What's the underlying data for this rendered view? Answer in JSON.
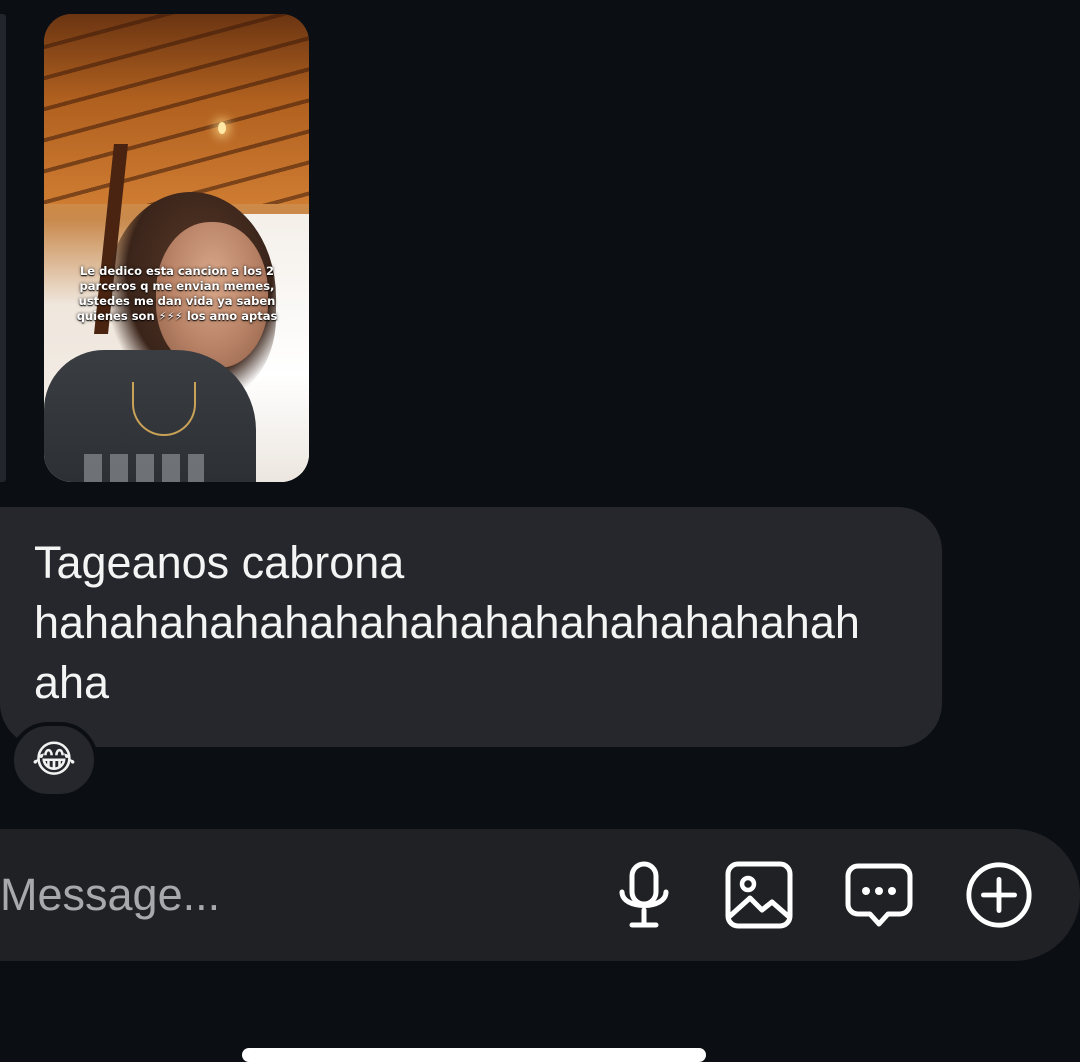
{
  "story": {
    "caption": "Le dedico esta cancion a los 2 parceros q me envian memes, ustedes me dan vida ya saben quienes son ⚡⚡⚡ los amo aptas"
  },
  "message": {
    "text": "Tageanos cabrona\nhahahahahahahahahahahahahahahahah\naha",
    "reaction_emoji": "😂"
  },
  "composer": {
    "placeholder": "Message...",
    "icons": [
      "microphone-icon",
      "image-icon",
      "chat-dots-icon",
      "plus-circle-icon"
    ]
  },
  "colors": {
    "background": "#0b0f14",
    "bubble": "#25272c",
    "composer": "#1f2125",
    "text": "#f4f4f4",
    "placeholder": "#a7a9ad"
  }
}
